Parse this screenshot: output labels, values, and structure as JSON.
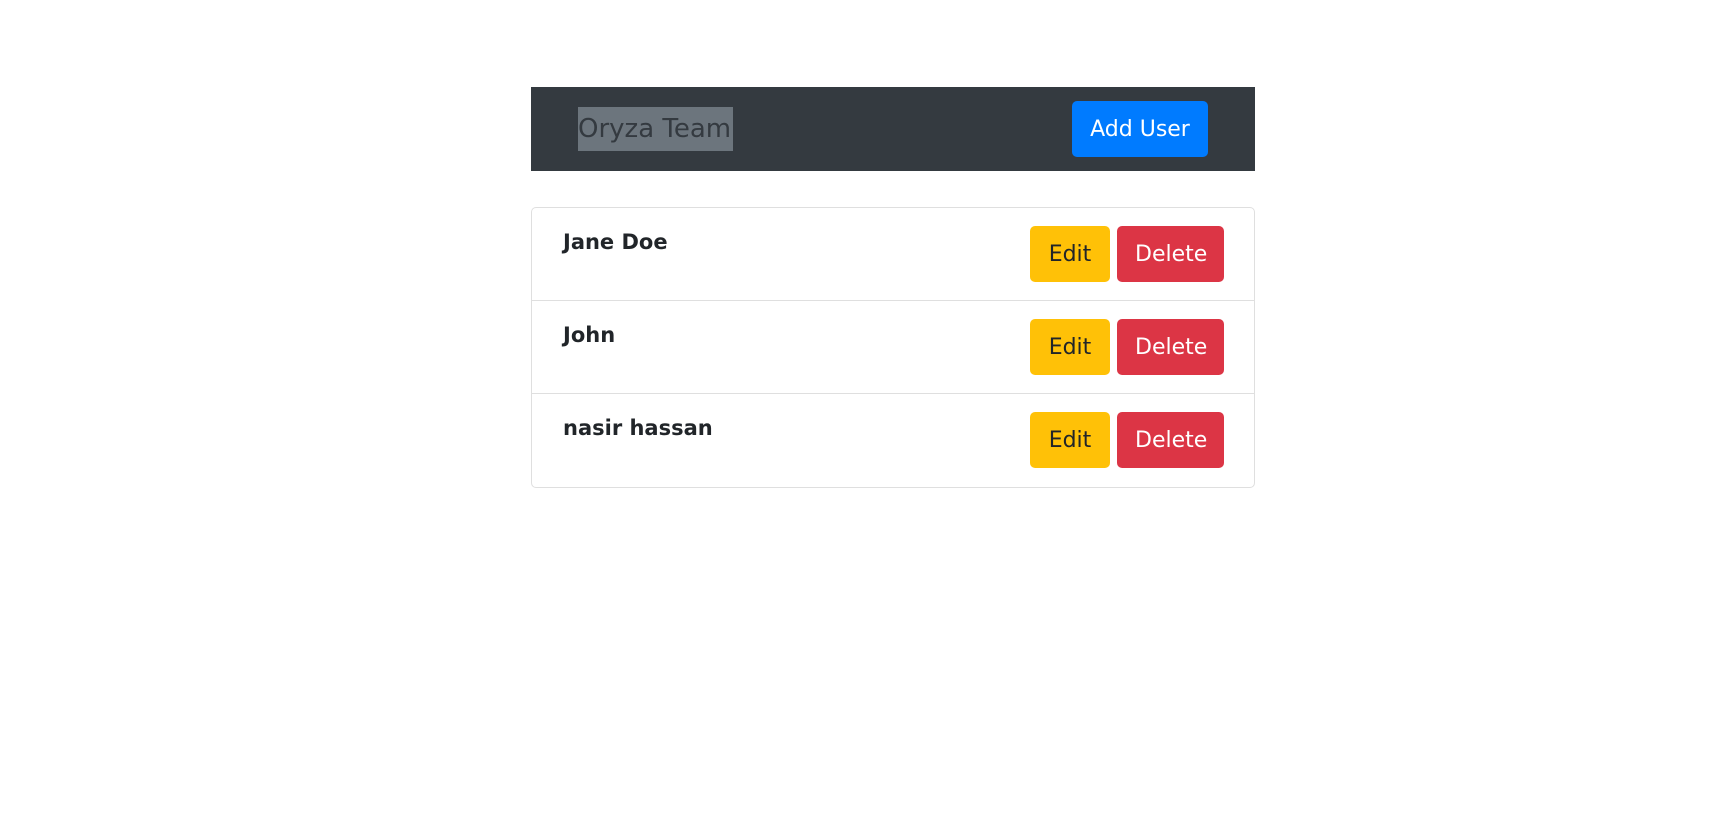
{
  "navbar": {
    "brand": "Oryza Team",
    "add_user_label": "Add User"
  },
  "users": [
    {
      "name": "Jane Doe",
      "edit_label": "Edit",
      "delete_label": "Delete"
    },
    {
      "name": "John",
      "edit_label": "Edit",
      "delete_label": "Delete"
    },
    {
      "name": "nasir hassan",
      "edit_label": "Edit",
      "delete_label": "Delete"
    }
  ],
  "colors": {
    "navbar_bg": "#343a40",
    "primary": "#007bff",
    "warning": "#ffc107",
    "danger": "#dc3545"
  }
}
